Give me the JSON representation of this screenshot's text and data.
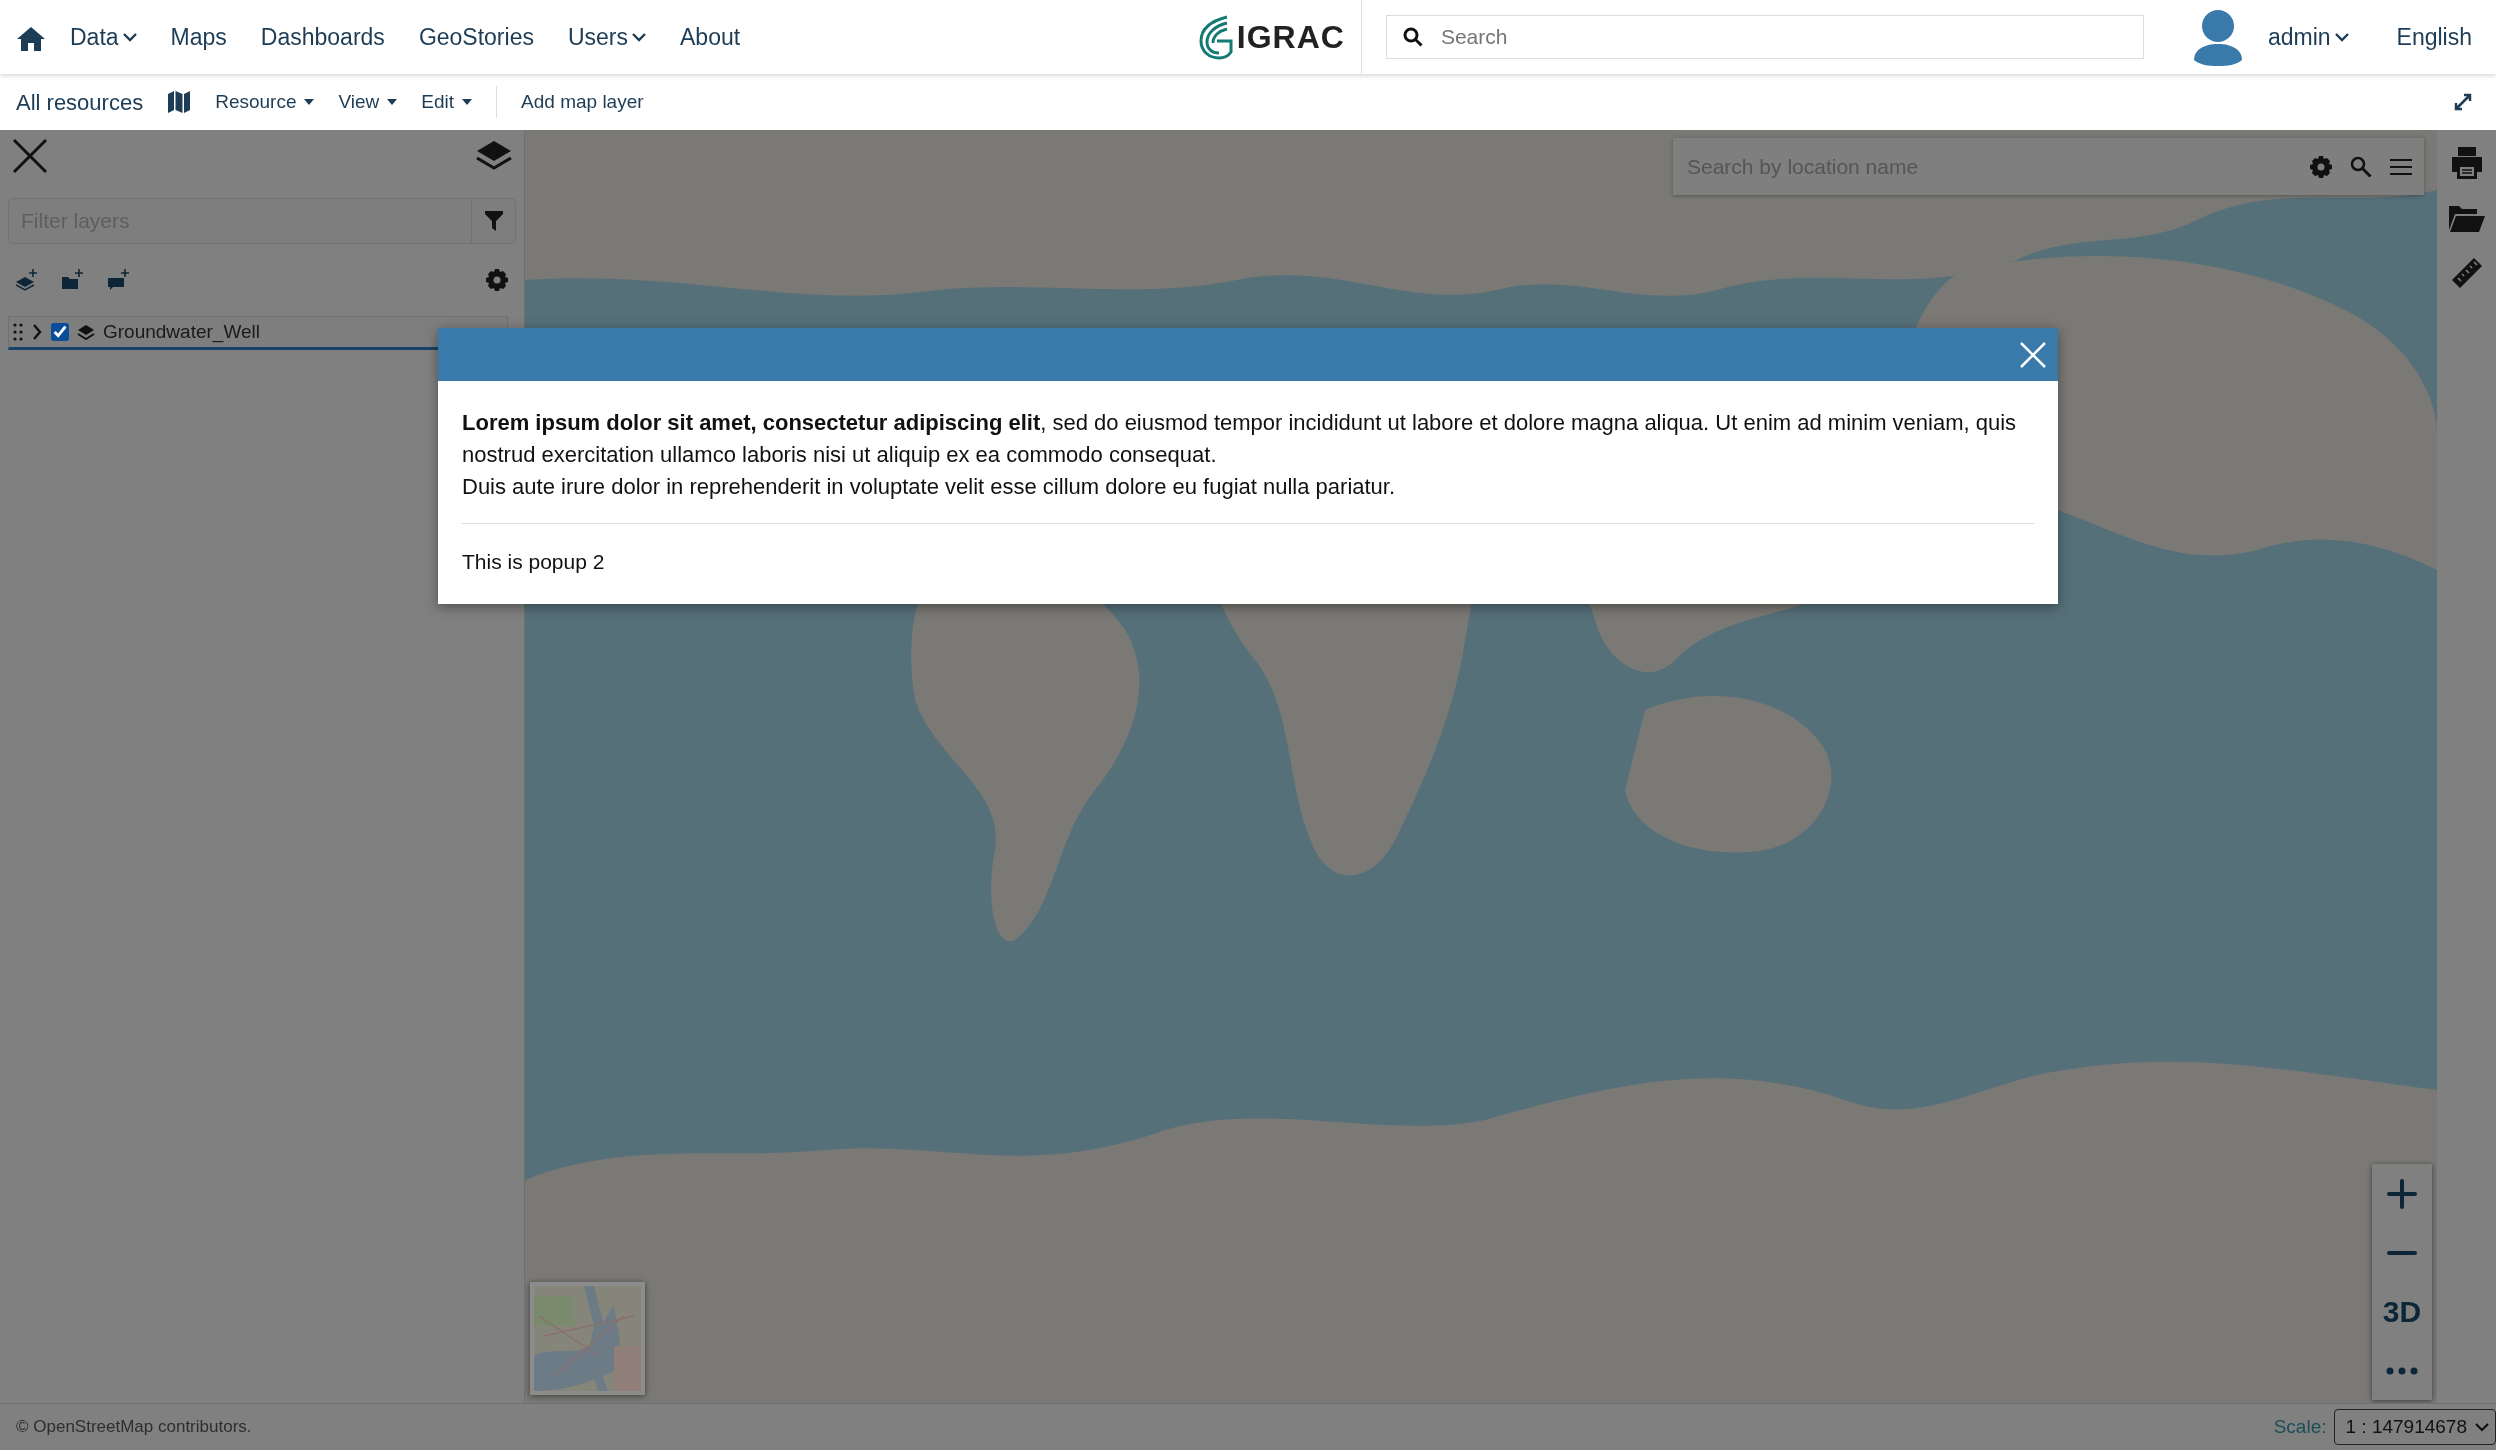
{
  "nav": {
    "items": [
      {
        "label": "Data",
        "dropdown": true
      },
      {
        "label": "Maps",
        "dropdown": false
      },
      {
        "label": "Dashboards",
        "dropdown": false
      },
      {
        "label": "GeoStories",
        "dropdown": false
      },
      {
        "label": "Users",
        "dropdown": true
      },
      {
        "label": "About",
        "dropdown": false
      }
    ],
    "logo": "IGRAC",
    "search": {
      "placeholder": "Search"
    },
    "user": "admin",
    "language": "English"
  },
  "toolbar": {
    "items": [
      {
        "kind": "link",
        "label": "All resources"
      },
      {
        "kind": "icon"
      },
      {
        "kind": "menu",
        "label": "Resource"
      },
      {
        "kind": "menu",
        "label": "View"
      },
      {
        "kind": "menu",
        "label": "Edit"
      },
      {
        "kind": "divider"
      },
      {
        "kind": "link",
        "label": "Add map layer"
      }
    ]
  },
  "sidebar": {
    "filter": {
      "placeholder": "Filter layers"
    },
    "layers": [
      {
        "name": "Groundwater_Well",
        "checked": true,
        "expanded": false
      }
    ]
  },
  "map_search": {
    "placeholder": "Search by location name"
  },
  "zoom_controls": {
    "view_toggle": "3D"
  },
  "modal": {
    "paragraphs": [
      "**Lorem ipsum dolor sit amet, consectetur adipiscing elit**, sed do eiusmod tempor incididunt ut labore et dolore magna aliqua. Ut enim ad minim veniam, quis nostrud exercitation ullamco laboris nisi ut aliquip ex ea commodo consequat.",
      "Duis aute irure dolor in reprehenderit in voluptate velit esse cillum dolore eu fugiat nulla pariatur."
    ],
    "footer": "This is popup 2"
  },
  "footer": {
    "attribution": "© OpenStreetMap contributors.",
    "scale_label": "Scale:",
    "scale": "1 : 147914678"
  }
}
